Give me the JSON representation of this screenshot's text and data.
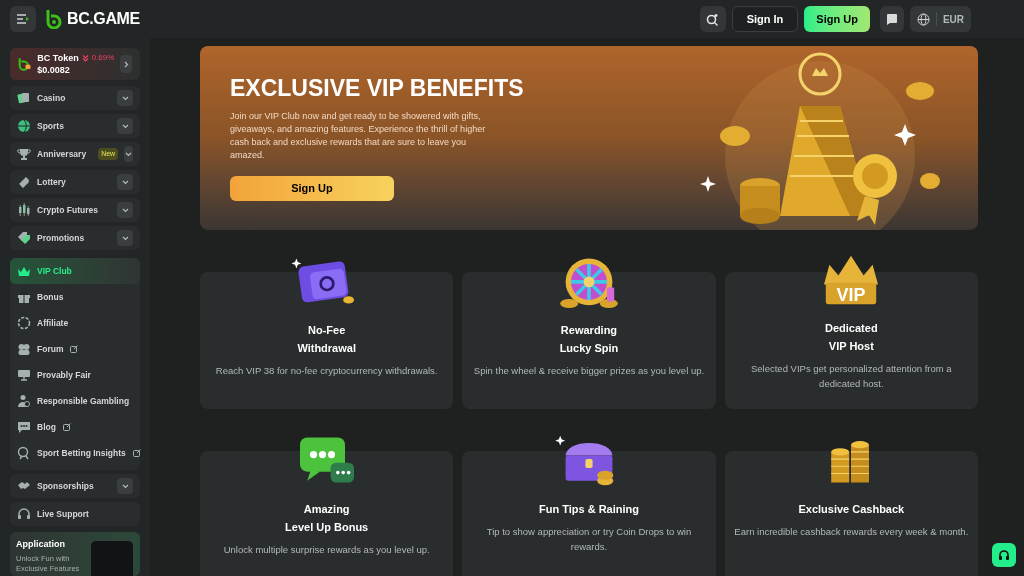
{
  "header": {
    "logo_text": "BC.GAME",
    "sign_in": "Sign In",
    "sign_up": "Sign Up",
    "currency": "EUR"
  },
  "sidebar": {
    "token": {
      "name": "BC Token",
      "change": "0.69%",
      "price": "$0.0082"
    },
    "groups": [
      {
        "items": [
          {
            "label": "Casino",
            "expandable": true
          }
        ]
      },
      {
        "items": [
          {
            "label": "Sports",
            "expandable": true
          }
        ]
      },
      {
        "items": [
          {
            "label": "Anniversary",
            "expandable": true,
            "badge": "New"
          }
        ]
      },
      {
        "items": [
          {
            "label": "Lottery",
            "expandable": true
          }
        ]
      },
      {
        "items": [
          {
            "label": "Crypto Futures",
            "expandable": true
          }
        ]
      },
      {
        "items": [
          {
            "label": "Promotions",
            "expandable": true
          }
        ]
      },
      {
        "items": [
          {
            "label": "VIP Club",
            "selected": true
          },
          {
            "label": "Bonus",
            "selected": false
          },
          {
            "label": "Affiliate",
            "selected": false
          },
          {
            "label": "Forum",
            "selected": false,
            "external": true
          },
          {
            "label": "Provably Fair",
            "selected": false
          },
          {
            "label": "Responsible Gambling",
            "selected": false
          },
          {
            "label": "Blog",
            "selected": false,
            "external": true
          },
          {
            "label": "Sport Betting Insights",
            "selected": false,
            "external": true
          }
        ]
      },
      {
        "items": [
          {
            "label": "Sponsorships",
            "expandable": true
          }
        ]
      },
      {
        "items": [
          {
            "label": "Live Support"
          }
        ]
      }
    ],
    "app_promo": {
      "title": "Application",
      "text": "Unlock Fun with Exclusive Features"
    }
  },
  "hero": {
    "title": "EXCLUSIVE VIP BENEFITS",
    "text": "Join our VIP Club now and get ready to be showered with gifts, giveaways, and amazing features. Experience the thrill of higher cash back and exclusive rewards that are sure to leave you amazed.",
    "button": "Sign Up"
  },
  "benefits": [
    {
      "title_lines": [
        "No-Fee",
        "Withdrawal"
      ],
      "text": "Reach VIP 38 for no-fee cryptocurrency withdrawals."
    },
    {
      "title_lines": [
        "Rewarding",
        "Lucky Spin"
      ],
      "text": "Spin the wheel & receive bigger prizes as you level up."
    },
    {
      "title_lines": [
        "Dedicated",
        "VIP Host"
      ],
      "text": "Selected VIPs get personalized attention from a dedicated host.",
      "icon_text": "VIP"
    },
    {
      "title_lines": [
        "Amazing",
        "Level Up Bonus"
      ],
      "text": "Unlock multiple surprise rewards as you level up."
    },
    {
      "title_lines": [
        "Fun Tips & Raining"
      ],
      "text": "Tip to show appreciation or try Coin Drops to win rewards."
    },
    {
      "title_lines": [
        "Exclusive Cashback"
      ],
      "text": "Earn incredible cashback rewards every week & month."
    }
  ]
}
